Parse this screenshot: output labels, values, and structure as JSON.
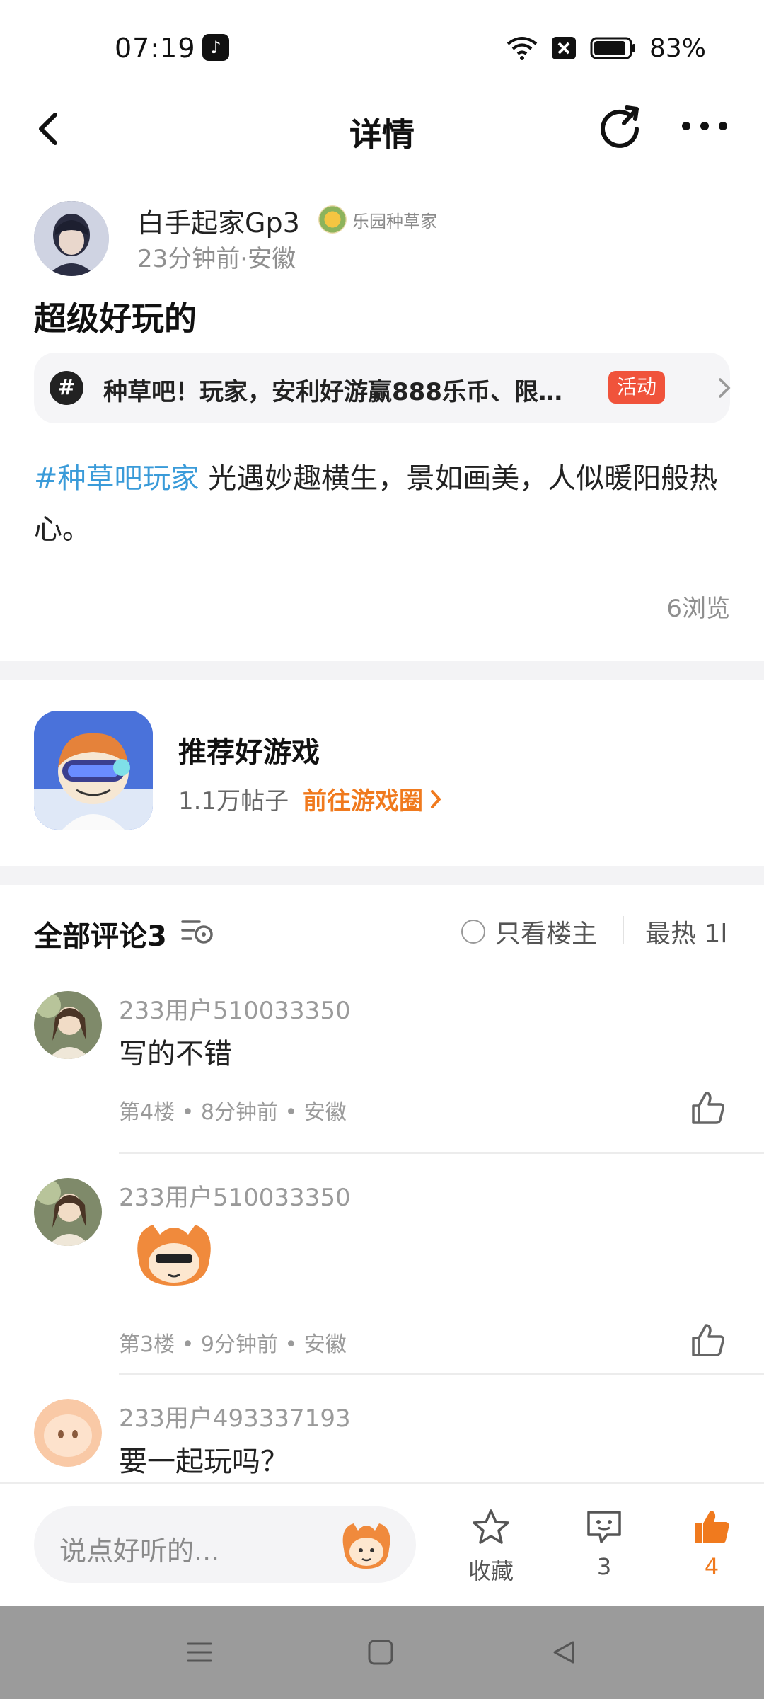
{
  "status_bar": {
    "time": "07:19",
    "battery": "83%"
  },
  "header": {
    "title": "详情"
  },
  "post": {
    "author": "白手起家Gp3",
    "badge": "乐园种草家",
    "meta": "23分钟前·安徽",
    "title": "超级好玩的",
    "activity": {
      "text": "种草吧！玩家，安利好游赢888乐币、限…",
      "tag": "活动"
    },
    "hashtag": "#种草吧玩家",
    "body": " 光遇妙趣横生，景如画美，人似暖阳般热心。",
    "views": "6浏览"
  },
  "game": {
    "name": "推荐好游戏",
    "posts": "1.1万帖子",
    "link": "前往游戏圈"
  },
  "comments_header": {
    "title": "全部评论3",
    "only_owner": "只看楼主",
    "sort": "最热 1l"
  },
  "comments": [
    {
      "user": "233用户510033350",
      "text": "写的不错",
      "meta": "第4楼 • 8分钟前 • 安徽"
    },
    {
      "user": "233用户510033350",
      "text": "",
      "meta": "第3楼 • 9分钟前 • 安徽"
    },
    {
      "user": "233用户493337193",
      "text": "要一起玩吗？",
      "meta": ""
    }
  ],
  "bottom_bar": {
    "input_placeholder": "说点好听的...",
    "favorite_label": "收藏",
    "comment_count": "3",
    "like_count": "4"
  },
  "colors": {
    "accent": "#f07a1e",
    "hashtag": "#3a9bd9",
    "activity_tag": "#f0533b"
  }
}
